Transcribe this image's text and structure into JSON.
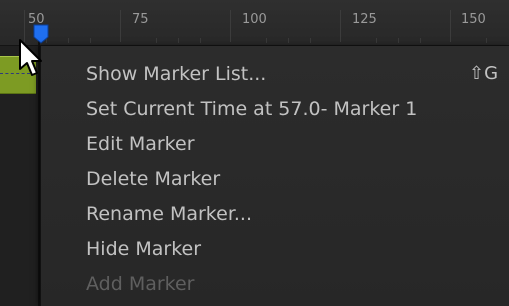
{
  "ruler": {
    "ticks": [
      "50",
      "75",
      "100",
      "125",
      "150"
    ]
  },
  "context_menu": {
    "items": [
      {
        "label": "Show Marker List...",
        "shortcut": "⇧G",
        "enabled": true
      },
      {
        "label": "Set Current Time at 57.0- Marker 1",
        "enabled": true
      },
      {
        "label": "Edit Marker",
        "enabled": true
      },
      {
        "label": "Delete Marker",
        "enabled": true
      },
      {
        "label": "Rename Marker...",
        "enabled": true
      },
      {
        "label": "Hide Marker",
        "enabled": true
      },
      {
        "label": "Add Marker",
        "enabled": false
      }
    ]
  },
  "colors": {
    "marker": "#1f6ff0",
    "clip": "#7d9b23",
    "menu_background": "#2a2a2a",
    "menu_text": "#c2c2c2",
    "menu_text_disabled": "#5f5f5f"
  }
}
